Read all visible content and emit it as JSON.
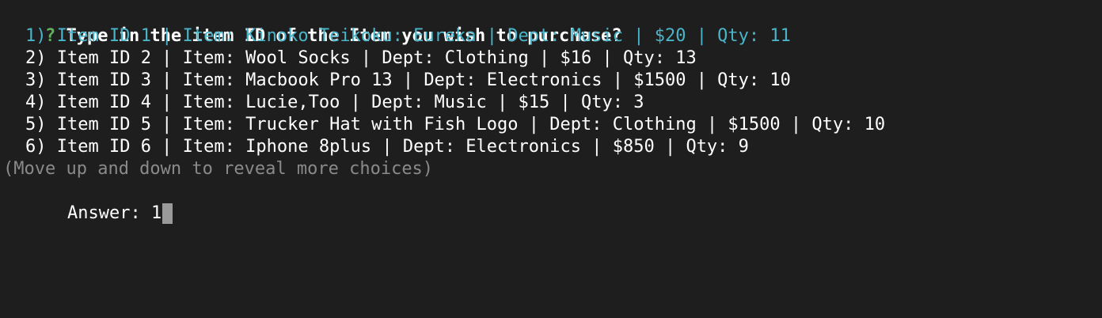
{
  "prompt": {
    "marker": "?",
    "question": "Type in the item ID of the Item you wish to purchase?"
  },
  "choices": [
    "1) Item ID 1 | Item: Kinoko Teikoku: Eureka | Dept: Music | $20 | Qty: 11",
    "2) Item ID 2 | Item: Wool Socks | Dept: Clothing | $16 | Qty: 13",
    "3) Item ID 3 | Item: Macbook Pro 13 | Dept: Electronics | $1500 | Qty: 10",
    "4) Item ID 4 | Item: Lucie,Too | Dept: Music | $15 | Qty: 3",
    "5) Item ID 5 | Item: Trucker Hat with Fish Logo | Dept: Clothing | $1500 | Qty: 10",
    "6) Item ID 6 | Item: Iphone 8plus | Dept: Electronics | $850 | Qty: 9"
  ],
  "selected_index": 0,
  "hint": "(Move up and down to reveal more choices)",
  "answer": {
    "label": "Answer:",
    "value": "1"
  },
  "colors": {
    "background": "#1e1e1e",
    "text": "#ffffff",
    "prompt_marker": "#5fb15c",
    "selected": "#4ab4c9",
    "hint": "#8a8a8a",
    "cursor": "#9a9a9a"
  }
}
